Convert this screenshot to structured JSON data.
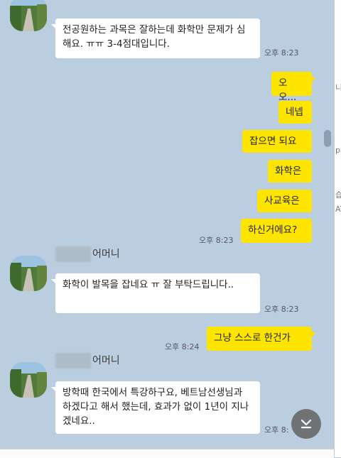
{
  "messages": [
    {
      "text": "전공원하는 과목은 잘하는데 화학만 문제가 심해요. ㅠㅠ 3-4점대입니다.",
      "time": "오후 8:23"
    },
    {
      "text": "오오...",
      "time": ""
    },
    {
      "text": "네넵",
      "time": ""
    },
    {
      "text": "잡으면 되요",
      "time": ""
    },
    {
      "text": "화학은",
      "time": ""
    },
    {
      "text": "사교육은",
      "time": ""
    },
    {
      "text": "하신거에요?",
      "time": "오후 8:23"
    },
    {
      "text": "화학이 발목을 잡네요 ㅠ 잘 부탁드립니다..",
      "time": "오후 8:23"
    },
    {
      "text": "그냥 스스로 한건가",
      "time": "오후 8:24"
    },
    {
      "text": "방학때 한국에서 특강하구요, 베트남선생님과 하겠다고 해서 했는데, 효과가 없이 1년이 지나겠네요..",
      "time": "오후 8:"
    }
  ],
  "sender_name": "어머니",
  "right_panel": {
    "chars": [
      "니",
      "pa",
      "습",
      "AT"
    ]
  },
  "icons": {
    "scroll_down": "chevron-down-to-line-icon",
    "avatar": "landscape-path-photo"
  },
  "colors": {
    "background": "#bacee0",
    "incoming": "#ffffff",
    "outgoing": "#fee500"
  }
}
